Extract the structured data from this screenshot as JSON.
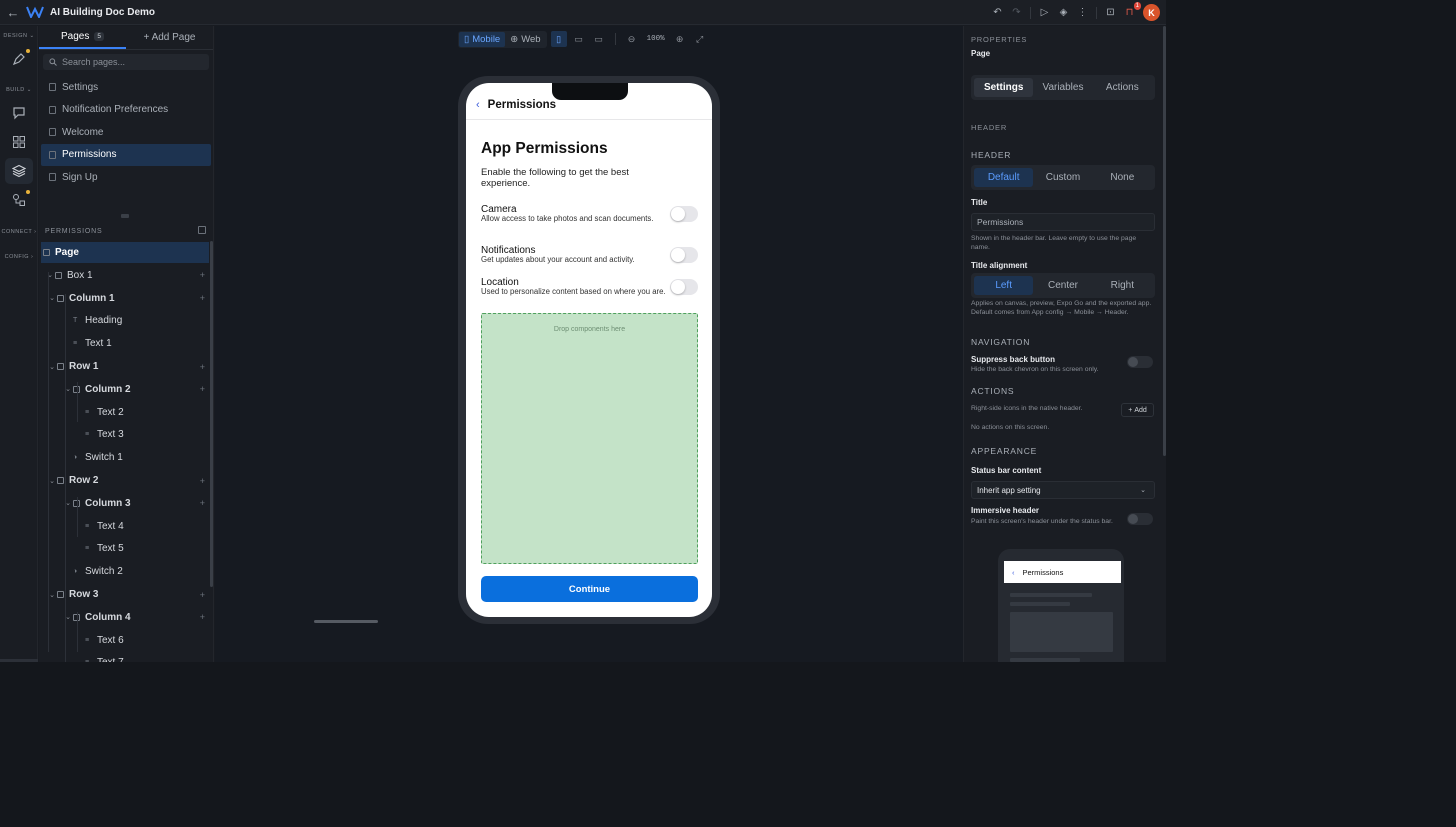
{
  "app": {
    "title": "AI Building Doc Demo",
    "avatar_initial": "K",
    "notification_count": "1"
  },
  "rail": {
    "design": "DESIGN",
    "build": "BUILD",
    "connect": "CONNECT",
    "config": "CONFIG"
  },
  "pages_panel": {
    "tab_pages": "Pages",
    "page_count": "5",
    "tab_add": "+ Add Page",
    "search_placeholder": "Search pages...",
    "pages": [
      "Settings",
      "Notification Preferences",
      "Welcome",
      "Permissions",
      "Sign Up"
    ],
    "selected_page": "Permissions"
  },
  "layers": {
    "header": "PERMISSIONS",
    "nodes": [
      "Page",
      "Box 1",
      "Column 1",
      "Heading",
      "Text 1",
      "Row 1",
      "Column 2",
      "Text 2",
      "Text 3",
      "Switch 1",
      "Row 2",
      "Column 3",
      "Text 4",
      "Text 5",
      "Switch 2",
      "Row 3",
      "Column 4",
      "Text 6",
      "Text 7"
    ]
  },
  "canvas": {
    "mode_mobile": "Mobile",
    "mode_web": "Web",
    "zoom": "100%"
  },
  "phone": {
    "header_title": "Permissions",
    "heading": "App Permissions",
    "subtitle": "Enable the following to get the best experience.",
    "permissions": [
      {
        "title": "Camera",
        "desc": "Allow access to take photos and scan documents."
      },
      {
        "title": "Notifications",
        "desc": "Get updates about your account and activity."
      },
      {
        "title": "Location",
        "desc": "Used to personalize content based on where you are."
      }
    ],
    "dropzone": "Drop components here",
    "button": "Continue"
  },
  "properties": {
    "caption": "PROPERTIES",
    "subject": "Page",
    "tabs": [
      "Settings",
      "Variables",
      "Actions"
    ],
    "section_header_cap": "HEADER",
    "header_label": "HEADER",
    "header_options": [
      "Default",
      "Custom",
      "None"
    ],
    "title_label": "Title",
    "title_value": "Permissions",
    "title_help": "Shown in the header bar. Leave empty to use the page name.",
    "align_label": "Title alignment",
    "align_options": [
      "Left",
      "Center",
      "Right"
    ],
    "align_help": "Applies on canvas, preview, Expo Go and the exported app. Default comes from App config → Mobile → Header.",
    "nav_cap": "NAVIGATION",
    "suppress_label": "Suppress back button",
    "suppress_help": "Hide the back chevron on this screen only.",
    "actions_cap": "ACTIONS",
    "actions_help": "Right-side icons in the native header.",
    "add_label": "Add",
    "no_actions": "No actions on this screen.",
    "appearance_cap": "APPEARANCE",
    "statusbar_label": "Status bar content",
    "statusbar_value": "Inherit app setting",
    "immersive_label": "Immersive header",
    "immersive_help": "Paint this screen's header under the status bar.",
    "preview_title": "Permissions"
  },
  "colors": {
    "accent": "#3b82f6",
    "primary_button": "#0a6fdd",
    "dropzone": "#c4e3c8",
    "avatar": "#d9542b"
  }
}
